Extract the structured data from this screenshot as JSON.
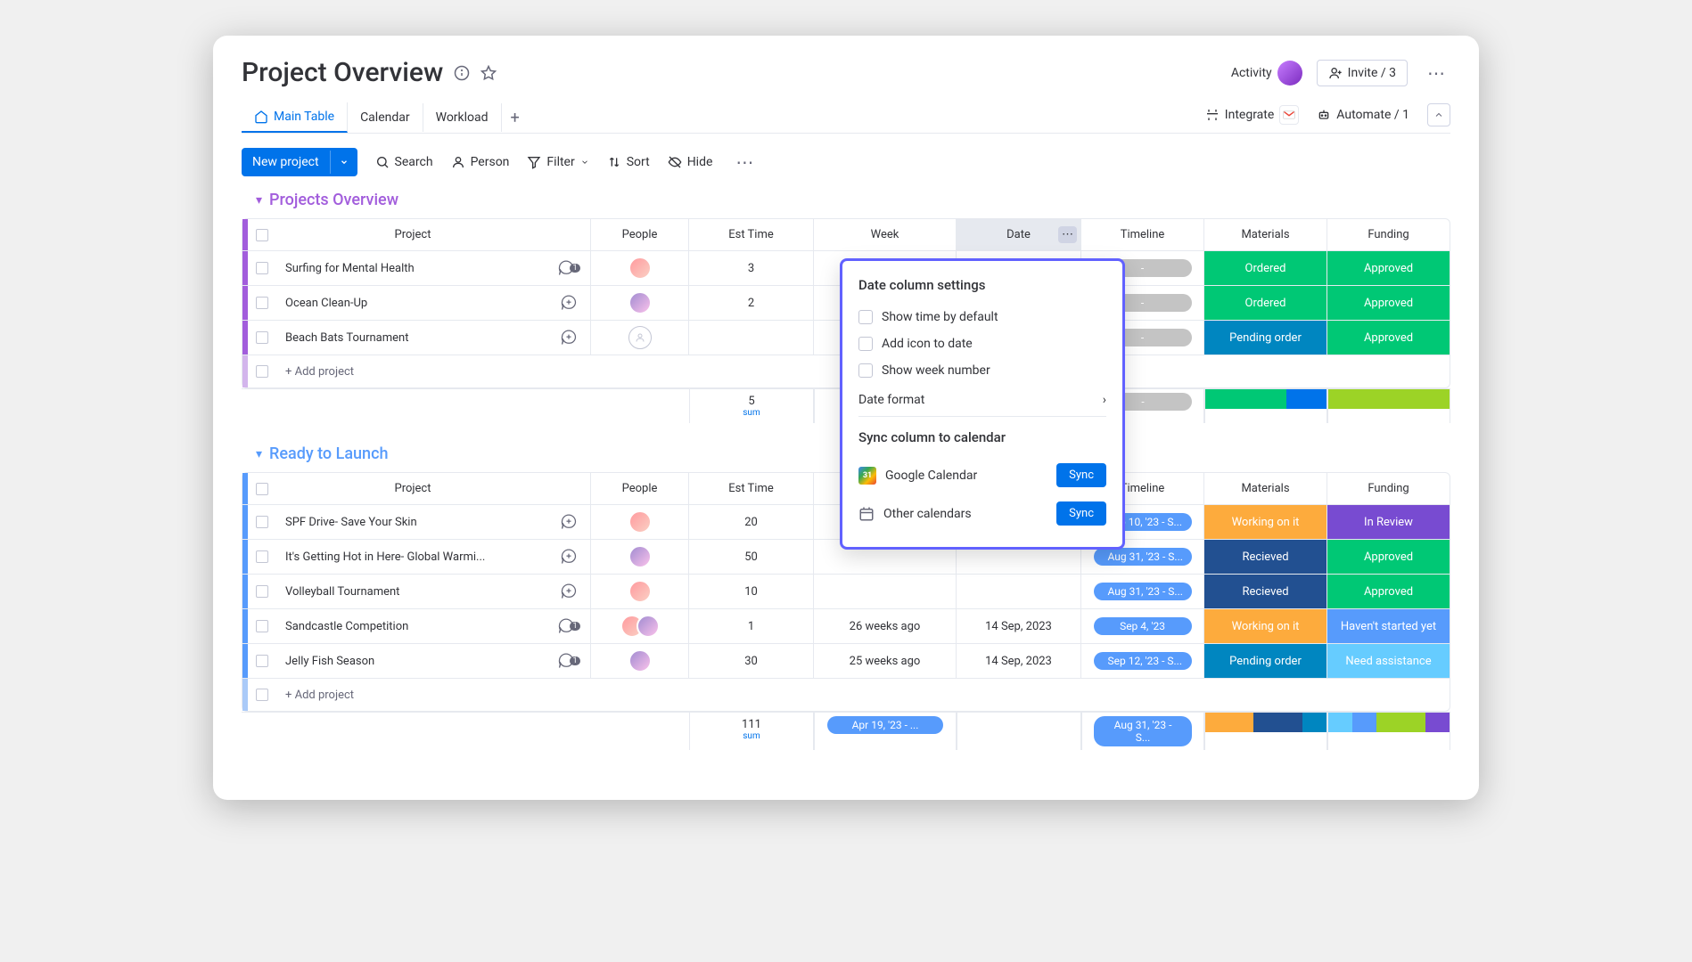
{
  "header": {
    "title": "Project Overview",
    "activity_label": "Activity",
    "invite_label": "Invite / 3"
  },
  "tabs": {
    "main_table": "Main Table",
    "calendar": "Calendar",
    "workload": "Workload"
  },
  "right_tools": {
    "integrate": "Integrate",
    "automate": "Automate / 1"
  },
  "toolbar": {
    "new_project": "New project",
    "search": "Search",
    "person": "Person",
    "filter": "Filter",
    "sort": "Sort",
    "hide": "Hide"
  },
  "columns": {
    "project": "Project",
    "people": "People",
    "est_time": "Est Time",
    "week": "Week",
    "date": "Date",
    "timeline": "Timeline",
    "materials": "Materials",
    "funding": "Funding"
  },
  "group1": {
    "title": "Projects Overview",
    "rows": [
      {
        "project": "Surfing for Mental Health",
        "est_time": "3",
        "timeline": "-",
        "materials": "Ordered",
        "funding": "Approved"
      },
      {
        "project": "Ocean Clean-Up",
        "est_time": "2",
        "timeline": "-",
        "materials": "Ordered",
        "funding": "Approved"
      },
      {
        "project": "Beach Bats Tournament",
        "est_time": "",
        "timeline": "-",
        "materials": "Pending order",
        "funding": "Approved"
      }
    ],
    "add_label": "+ Add project",
    "sum_value": "5",
    "sum_label": "sum",
    "sum_timeline": "-"
  },
  "group2": {
    "title": "Ready to Launch",
    "rows": [
      {
        "project": "SPF Drive- Save Your Skin",
        "est_time": "20",
        "week": "",
        "date": "",
        "timeline": "Sep 10, '23 - S...",
        "materials": "Working on it",
        "funding": "In Review"
      },
      {
        "project": "It's Getting Hot in Here- Global Warmi...",
        "est_time": "50",
        "week": "",
        "date": "",
        "timeline": "Aug 31, '23 - S...",
        "materials": "Recieved",
        "funding": "Approved"
      },
      {
        "project": "Volleyball Tournament",
        "est_time": "10",
        "week": "",
        "date": "",
        "timeline": "Aug 31, '23 - S...",
        "materials": "Recieved",
        "funding": "Approved"
      },
      {
        "project": "Sandcastle Competition",
        "est_time": "1",
        "week": "26 weeks ago",
        "date": "14 Sep, 2023",
        "timeline": "Sep 4, '23",
        "materials": "Working on it",
        "funding": "Haven't started yet"
      },
      {
        "project": "Jelly Fish Season",
        "est_time": "30",
        "week": "25 weeks ago",
        "date": "14 Sep, 2023",
        "timeline": "Sep 12, '23 - S...",
        "materials": "Pending order",
        "funding": "Need assistance"
      }
    ],
    "add_label": "+ Add project",
    "sum_value": "111",
    "sum_label": "sum",
    "sum_week_pill": "Apr 19, '23 - ...",
    "sum_timeline_pill": "Aug 31, '23 - S..."
  },
  "popup": {
    "title": "Date column settings",
    "opt1": "Show time by default",
    "opt2": "Add icon to date",
    "opt3": "Show week number",
    "date_format": "Date format",
    "sync_title": "Sync column to calendar",
    "gcal": "Google Calendar",
    "other_cal": "Other calendars",
    "sync_btn": "Sync"
  }
}
